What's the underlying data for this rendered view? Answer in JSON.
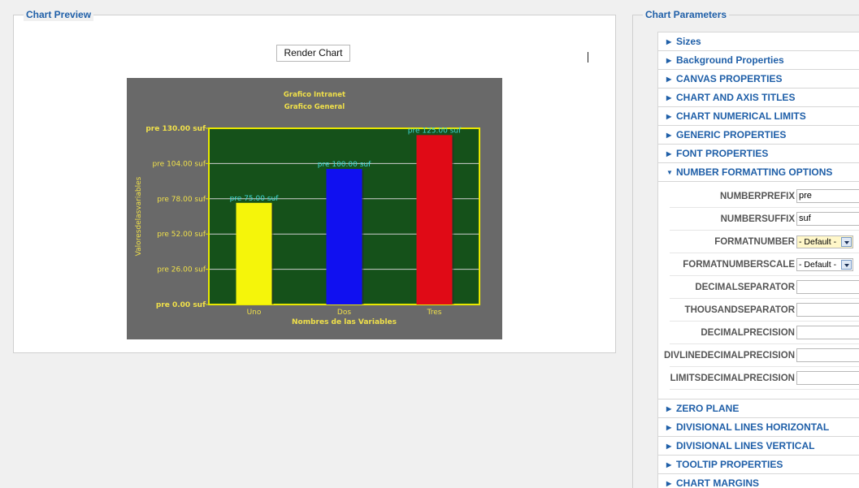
{
  "preview": {
    "title": "Chart Preview",
    "render_button": "Render Chart"
  },
  "params": {
    "title": "Chart Parameters",
    "sections_top": [
      "Sizes",
      "Background Properties",
      "CANVAS PROPERTIES",
      "CHART AND AXIS TITLES",
      "CHART NUMERICAL LIMITS",
      "GENERIC PROPERTIES",
      "FONT PROPERTIES"
    ],
    "open_section": "NUMBER FORMATTING OPTIONS",
    "fields": [
      {
        "label": "NUMBERPREFIX",
        "kind": "input",
        "value": "pre"
      },
      {
        "label": "NUMBERSUFFIX",
        "kind": "input",
        "value": "suf"
      },
      {
        "label": "FORMATNUMBER",
        "kind": "select",
        "value": "- Default -",
        "highlight": true
      },
      {
        "label": "FORMATNUMBERSCALE",
        "kind": "select",
        "value": "- Default -",
        "highlight": false
      },
      {
        "label": "DECIMALSEPARATOR",
        "kind": "input",
        "value": ""
      },
      {
        "label": "THOUSANDSEPARATOR",
        "kind": "input",
        "value": ""
      },
      {
        "label": "DECIMALPRECISION",
        "kind": "input",
        "value": ""
      },
      {
        "label": "DIVLINEDECIMALPRECISION",
        "kind": "input",
        "value": ""
      },
      {
        "label": "LIMITSDECIMALPRECISION",
        "kind": "input",
        "value": ""
      }
    ],
    "sections_bottom": [
      "ZERO PLANE",
      "DIVISIONAL LINES HORIZONTAL",
      "DIVISIONAL LINES VERTICAL",
      "TOOLTIP PROPERTIES",
      "CHART MARGINS"
    ]
  },
  "chart_data": {
    "type": "bar",
    "title": "Grafico Intranet",
    "subtitle": "Grafico General",
    "xlabel": "Nombres de las Variables",
    "ylabel": "Valoresdelasvariables",
    "categories": [
      "Uno",
      "Dos",
      "Tres"
    ],
    "values": [
      75,
      100,
      125
    ],
    "data_labels": [
      "pre 75.00 suf",
      "pre 100.00 suf",
      "pre 125.00 suf"
    ],
    "bar_colors": [
      "#f5f50a",
      "#1010f0",
      "#e00a16"
    ],
    "yticks": [
      0,
      26,
      52,
      78,
      104,
      130
    ],
    "ytick_labels": [
      "pre 0.00 suf",
      "pre 26.00 suf",
      "pre 52.00 suf",
      "pre 78.00 suf",
      "pre 104.00 suf",
      "pre 130.00 suf"
    ],
    "ylim": [
      0,
      130
    ],
    "grid": true,
    "colors": {
      "background": "#696969",
      "canvas": "#15511a",
      "canvas_border": "#e8e800",
      "text": "#f0e04a",
      "data_label": "#3fd6d6",
      "gridline": "#d0d0d0"
    }
  }
}
